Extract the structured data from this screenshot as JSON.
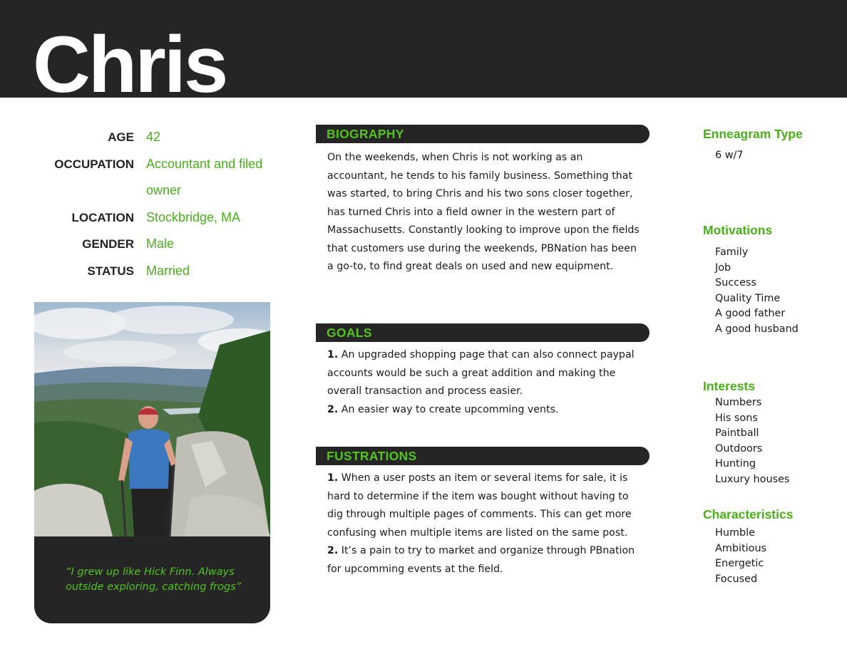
{
  "persona": {
    "name": "Chris"
  },
  "info": {
    "age": {
      "label": "AGE",
      "value": "42"
    },
    "occupation": {
      "label": "OCCUPATION",
      "value": "Accountant and filed owner"
    },
    "location": {
      "label": "LOCATION",
      "value": "Stockbridge, MA"
    },
    "gender": {
      "label": "GENDER",
      "value": "Male"
    },
    "status": {
      "label": "STATUS",
      "value": "Married"
    }
  },
  "quote": "“I grew up like Hick Finn. Always outside exploring, catching frogs”",
  "biography": {
    "title": "BIOGRAPHY",
    "text": "On the weekends, when Chris is not working as an accountant, he tends to his family business. Something that was started, to bring Chris and his two sons closer together, has turned Chris into a field owner in the western part of Massachusetts. Constantly looking to improve upon the fields that customers use during the weekends, PBNation has been a go-to, to find great deals on used and new equipment."
  },
  "goals": {
    "title": "GOALS",
    "items": [
      {
        "num": "1.",
        "text": "An upgraded shopping page that can also connect paypal accounts would be such a great addition and making the overall transaction and process easier."
      },
      {
        "num": "2.",
        "text": "An easier way to create upcomming vents."
      }
    ]
  },
  "frustrations": {
    "title": "FUSTRATIONS",
    "items": [
      {
        "num": "1.",
        "text": "When a user posts an item or several items for sale, it is hard to determine if the item was bought without having to dig through multiple pages of comments. This can get more confusing when multiple items are listed on the same post."
      },
      {
        "num": "2.",
        "text": "It’s a pain to try to market and organize through PBnation for upcomming events at the field."
      }
    ]
  },
  "enneagram": {
    "title": "Enneagram Type",
    "value": "6 w/7"
  },
  "motivations": {
    "title": "Motivations",
    "items": [
      "Family",
      "Job",
      "Success",
      "Quality Time",
      "A good father",
      "A good husband"
    ]
  },
  "interests": {
    "title": "Interests",
    "items": [
      "Numbers",
      "His sons",
      "Paintball",
      "Outdoors",
      "Hunting",
      "Luxury houses"
    ]
  },
  "characteristics": {
    "title": "Characteristics",
    "items": [
      "Humble",
      "Ambitious",
      "Energetic",
      "Focused"
    ]
  },
  "colors": {
    "accent": "#48b018",
    "dark": "#252525"
  }
}
